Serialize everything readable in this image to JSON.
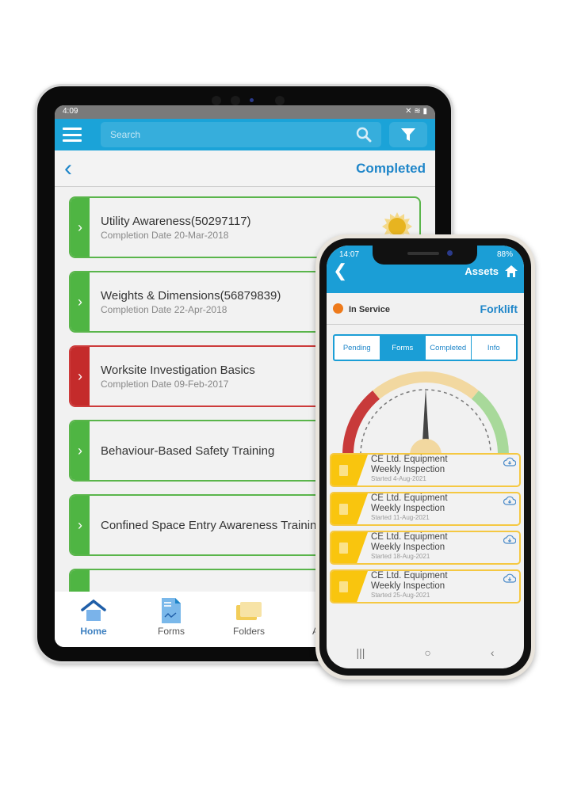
{
  "tablet": {
    "status_time": "4:09",
    "search_placeholder": "Search",
    "page_title": "Completed",
    "cards": [
      {
        "title": "Utility Awareness(50297117)",
        "date": "Completion Date 20-Mar-2018",
        "status": "green",
        "badge": "award-seal"
      },
      {
        "title": "Weights & Dimensions(56879839)",
        "date": "Completion Date 22-Apr-2018",
        "status": "green"
      },
      {
        "title": "Worksite Investigation Basics",
        "date": "Completion Date 09-Feb-2017",
        "status": "red"
      },
      {
        "title": "Behaviour-Based Safety Training",
        "date": "",
        "status": "green"
      },
      {
        "title": "Confined Space Entry Awareness Training",
        "date": "",
        "status": "green"
      },
      {
        "title": "",
        "date": "",
        "status": "green"
      }
    ],
    "nav": [
      {
        "label": "Home",
        "icon": "home-icon",
        "active": true
      },
      {
        "label": "Forms",
        "icon": "forms-icon"
      },
      {
        "label": "Folders",
        "icon": "folders-icon"
      },
      {
        "label": "Assets",
        "icon": "assets-icon"
      }
    ]
  },
  "phone": {
    "status_time": "14:07",
    "battery": "88%",
    "header_title": "Assets",
    "status_label": "In Service",
    "status_color": "#ee7a1b",
    "asset_name": "Forklift",
    "tabs": [
      {
        "label": "Pending"
      },
      {
        "label": "Forms",
        "active": true
      },
      {
        "label": "Completed"
      },
      {
        "label": "Info"
      }
    ],
    "gauge": {
      "value_fraction": 0.5,
      "segments": [
        "#c83a3a",
        "#f2d8a0",
        "#a8d99a"
      ]
    },
    "forms": [
      {
        "line1": "CE Ltd. Equipment",
        "line2": "Weekly Inspection",
        "started": "Started   4-Aug-2021"
      },
      {
        "line1": "CE Ltd. Equipment",
        "line2": "Weekly Inspection",
        "started": "Started 11-Aug-2021"
      },
      {
        "line1": "CE Ltd. Equipment",
        "line2": "Weekly Inspection",
        "started": "Started 18-Aug-2021"
      },
      {
        "line1": "CE Ltd. Equipment",
        "line2": "Weekly Inspection",
        "started": "Started 25-Aug-2021"
      }
    ],
    "nav": {
      "recents": "|||",
      "home": "○",
      "back": "‹"
    }
  }
}
